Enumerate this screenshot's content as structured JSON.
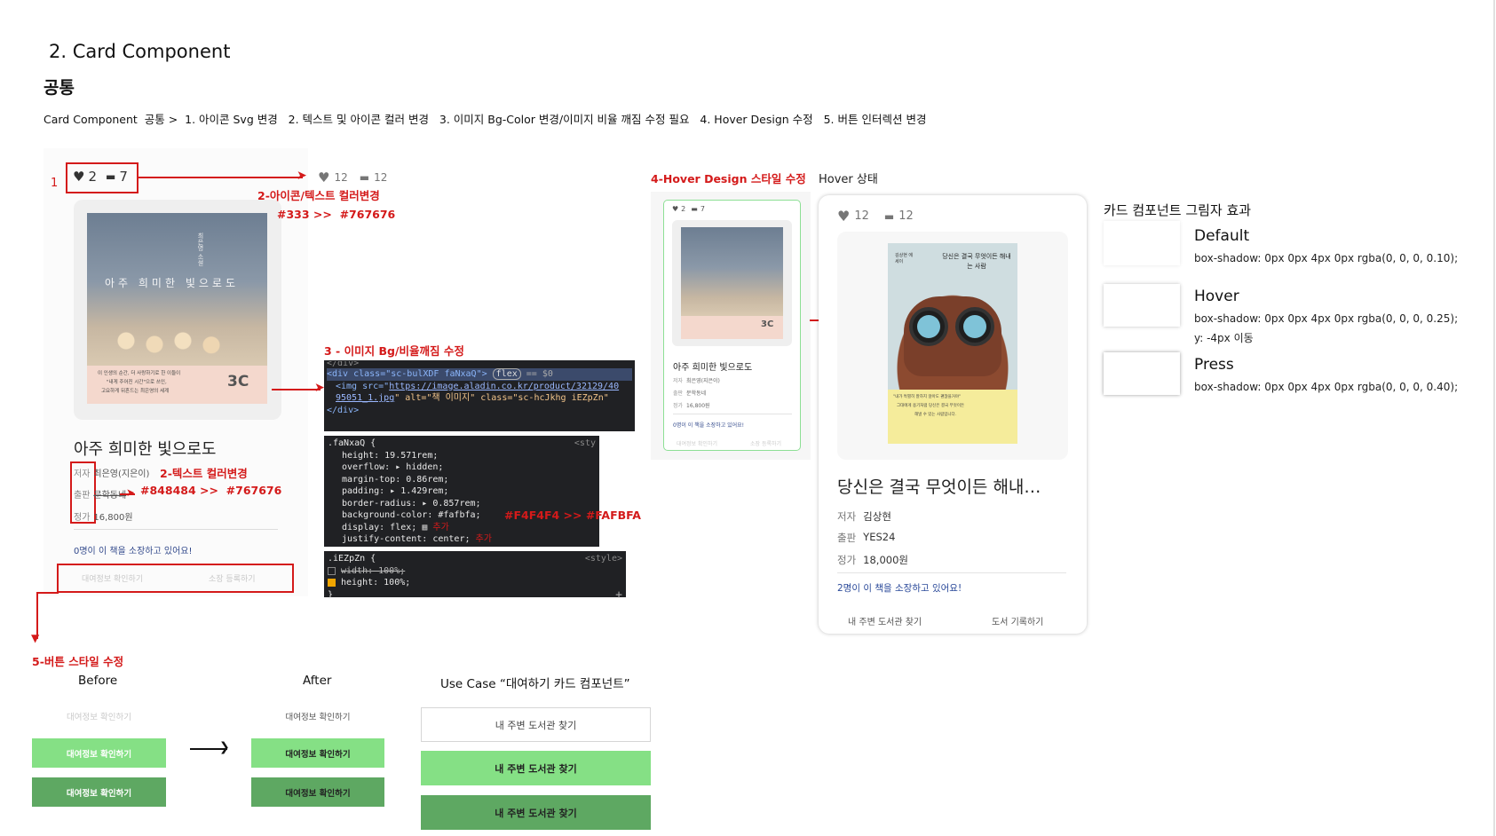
{
  "header": {
    "section_title": "2. Card Component",
    "subtitle": "공통",
    "description": "Card Component  공통 >  1. 아이콘 Svg 변경   2. 텍스트 및 아이콘 컬러 변경   3. 이미지 Bg-Color 변경/이미지 비율 깨짐 수정 필요   4. Hover Design 수정   5. 버튼 인터렉션 변경"
  },
  "annotations": {
    "n1": "1",
    "n2_icon_text": "2-아이콘/텍스트 컬러변경",
    "n2_icon_colors": "#333 >>  #767676",
    "n2_text": "2-텍스트 컬러변경",
    "n2_text_colors": "#848484 >>  #767676",
    "n3": "3 - 이미지 Bg/비율깨짐 수정",
    "n4": "4-Hover Design 스타일 수정",
    "hover_state": "Hover 상태",
    "n5": "5-버튼 스타일 수정"
  },
  "old_card": {
    "likes": "2",
    "comments": "7",
    "book_title": "아주 희미한 빛으로도",
    "cover_top": "최은영 소설",
    "cover_title": "아주 희미한 빛으로도",
    "cover_caption1": "이 인생의 순간, 더 사랑하기로 한 이들이",
    "cover_caption2": "\"내게 주어진 시간\"으로 쓰인,",
    "cover_caption3": "고요하게 뒤흔드는 최은영의 세계",
    "author_label": "저자",
    "author": "최은영(지은이)",
    "publisher_label": "출판",
    "publisher": "문학동네",
    "price_label": "정가",
    "price": "16,800원",
    "owners": "0명이 이 책을 소장하고 있어요!",
    "btn_rental": "대여정보 확인하기",
    "btn_register": "소장 등록하기"
  },
  "new_icons": {
    "likes": "12",
    "comments": "12"
  },
  "code_blocks": {
    "html_line0": "</div>",
    "html_line1": "<div class=\"sc-bulXDF faNxaQ\">",
    "html_flex_tag": "flex",
    "html_eq": "== $0",
    "html_line2a": "<img src=\"",
    "html_line2_url": "https://image.aladin.co.kr/product/32129/40",
    "html_line3_url": "95051_1.jpg",
    "html_line3_rest": "\" alt=\"책 이미지\" class=\"sc-hcJkhg iEZpZn\"",
    "html_line4": "</div>",
    "css1_selector": ".faNxaQ {",
    "css1_source": "<sty",
    "css1_props": [
      "height: 19.571rem;",
      "overflow: ▸ hidden;",
      "margin-top: 0.86rem;",
      "padding: ▸ 1.429rem;",
      "border-radius: ▸ 0.857rem;",
      "background-color: #fafbfa;",
      "display: flex;",
      "justify-content: center;"
    ],
    "css1_bg_note": "#F4F4F4 >> #FAFBFA",
    "css1_add1": "추가",
    "css1_add2": "추가",
    "css2_selector": ".iEZpZn {",
    "css2_source": "<style>",
    "css2_prop1": "width: 100%;",
    "css2_prop2": "height: 100%;",
    "css2_close": "}",
    "css2_plus": "+"
  },
  "hover_small_card": {
    "likes": "2",
    "comments": "7",
    "book_title": "아주 희미한 빛으로도",
    "author_label": "저자",
    "author": "최은영(지은이)",
    "publisher_label": "출판",
    "publisher": "문학동네",
    "price_label": "정가",
    "price": "16,800원",
    "owners": "0명이 이 책을 소장하고 있어요!",
    "btn_rental": "대여정보 확인하기",
    "btn_register": "소장 등록하기"
  },
  "hover_card": {
    "likes": "12",
    "comments": "12",
    "cover_small": "김상현 에세이",
    "cover_title": "당신은 결국 무엇이든 해내는 사람",
    "cover_quote1": "\"내가 특별히 잘하지 않아도 괜찮을거야\"",
    "cover_quote2": "그대에게 용기처럼 당신은 결국 무엇이든",
    "cover_quote3": "해낼 수 있는 사람입니다.",
    "book_title": "당신은 결국 무엇이든 해내…",
    "author_label": "저자",
    "author": "김상현",
    "publisher_label": "출판",
    "publisher": "YES24",
    "price_label": "정가",
    "price": "18,000원",
    "owners": "2명이 이 책을 소장하고 있어요!",
    "btn_find": "내 주변 도서관 찾기",
    "btn_record": "도서 기록하기"
  },
  "shadows": {
    "title": "카드 컴포넌트 그림자 효과",
    "default_label": "Default",
    "default_value": "box-shadow: 0px 0px 4px 0px rgba(0, 0, 0, 0.10);",
    "hover_label": "Hover",
    "hover_value": "box-shadow: 0px 0px 4px 0px rgba(0, 0, 0, 0.25);",
    "hover_extra": "y: -4px 이동",
    "press_label": "Press",
    "press_value": "box-shadow: 0px 0px 4px 0px rgba(0, 0, 0, 0.40);"
  },
  "button_styles": {
    "before_label": "Before",
    "after_label": "After",
    "usecase_label": "Use Case “대여하기 카드 컴포넌트”",
    "before_default": "대여정보 확인하기",
    "before_hover": "대여정보 확인하기",
    "before_press": "대여정보 확인하기",
    "after_default": "대여정보 확인하기",
    "after_hover": "대여정보 확인하기",
    "after_press": "대여정보 확인하기",
    "use_default": "내 주변 도서관 찾기",
    "use_hover": "내 주변 도서관 찾기",
    "use_press": "내 주변 도서관 찾기"
  },
  "colors": {
    "accent_red": "#d41a1a",
    "green_light": "#85e085",
    "green_dark": "#5ea862",
    "text_gray": "#767676"
  }
}
